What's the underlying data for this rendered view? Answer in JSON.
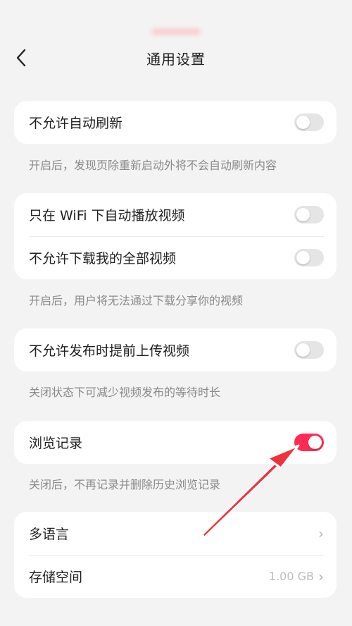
{
  "header": {
    "title": "通用设置"
  },
  "sections": [
    {
      "rows": [
        {
          "label": "不允许自动刷新",
          "on": false
        }
      ],
      "hint": "开启后，发现页除重新启动外将不会自动刷新内容"
    },
    {
      "rows": [
        {
          "label": "只在 WiFi 下自动播放视频",
          "on": false
        },
        {
          "label": "不允许下载我的全部视频",
          "on": false
        }
      ],
      "hint": "开启后，用户将无法通过下载分享你的视频"
    },
    {
      "rows": [
        {
          "label": "不允许发布时提前上传视频",
          "on": false
        }
      ],
      "hint": "关闭状态下可减少视频发布的等待时长"
    },
    {
      "rows": [
        {
          "label": "浏览记录",
          "on": true
        }
      ],
      "hint": "关闭后，不再记录并删除历史浏览记录"
    }
  ],
  "more": {
    "language_label": "多语言",
    "storage_label": "存储空间",
    "storage_value": "1.00 GB"
  },
  "colors": {
    "accent": "#fe2c55",
    "background": "#f3f3f3",
    "card": "#ffffff"
  }
}
